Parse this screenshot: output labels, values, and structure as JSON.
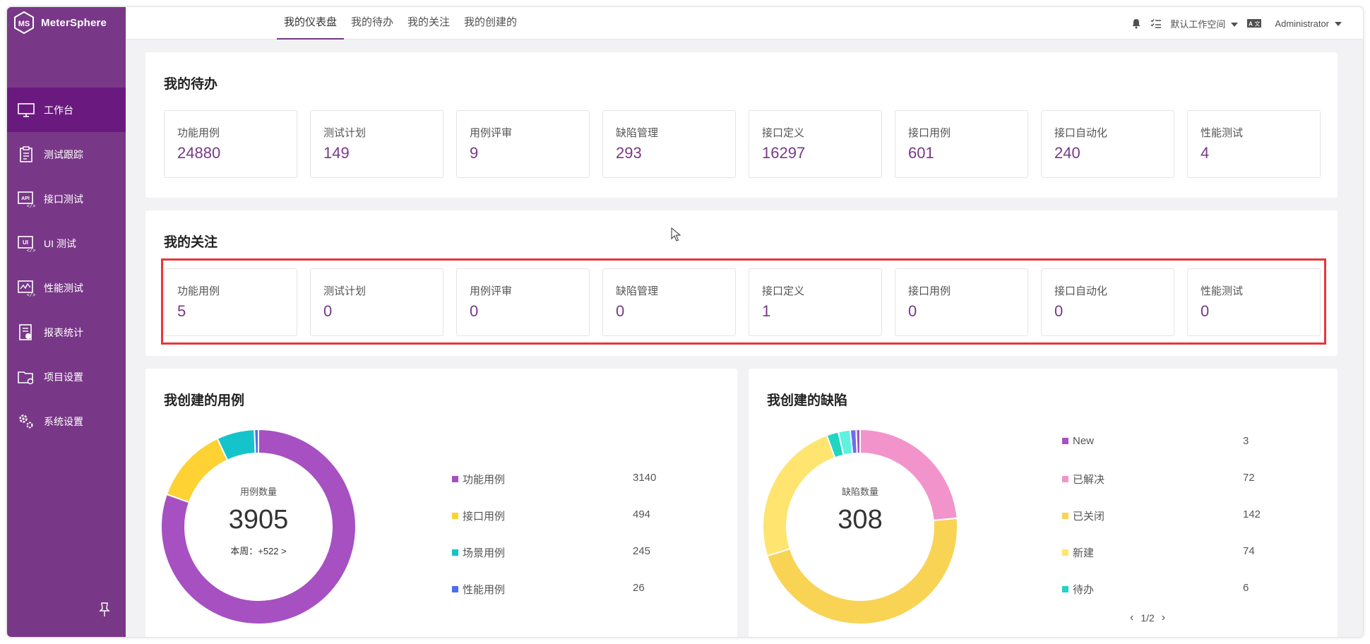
{
  "app": {
    "brand": "MeterSphere"
  },
  "sidebar": {
    "items": [
      {
        "label": "工作台",
        "icon": "monitor-icon"
      },
      {
        "label": "测试跟踪",
        "icon": "clipboard-icon"
      },
      {
        "label": "接口测试",
        "icon": "api-icon"
      },
      {
        "label": "UI 测试",
        "icon": "ui-icon"
      },
      {
        "label": "性能测试",
        "icon": "performance-icon"
      },
      {
        "label": "报表统计",
        "icon": "report-icon"
      },
      {
        "label": "项目设置",
        "icon": "folder-gear-icon"
      },
      {
        "label": "系统设置",
        "icon": "gears-icon"
      }
    ]
  },
  "topbar": {
    "tabs": [
      "我的仪表盘",
      "我的待办",
      "我的关注",
      "我的创建的"
    ],
    "workspace": "默认工作空间",
    "user": "Administrator"
  },
  "todo": {
    "title": "我的待办",
    "stats": [
      {
        "label": "功能用例",
        "value": "24880"
      },
      {
        "label": "测试计划",
        "value": "149"
      },
      {
        "label": "用例评审",
        "value": "9"
      },
      {
        "label": "缺陷管理",
        "value": "293"
      },
      {
        "label": "接口定义",
        "value": "16297"
      },
      {
        "label": "接口用例",
        "value": "601"
      },
      {
        "label": "接口自动化",
        "value": "240"
      },
      {
        "label": "性能测试",
        "value": "4"
      }
    ]
  },
  "follow": {
    "title": "我的关注",
    "stats": [
      {
        "label": "功能用例",
        "value": "5"
      },
      {
        "label": "测试计划",
        "value": "0"
      },
      {
        "label": "用例评审",
        "value": "0"
      },
      {
        "label": "缺陷管理",
        "value": "0"
      },
      {
        "label": "接口定义",
        "value": "1"
      },
      {
        "label": "接口用例",
        "value": "0"
      },
      {
        "label": "接口自动化",
        "value": "0"
      },
      {
        "label": "性能测试",
        "value": "0"
      }
    ]
  },
  "cases": {
    "title": "我创建的用例",
    "center_caption": "用例数量",
    "center_value": "3905",
    "weekly": "本周：+522 >"
  },
  "defects": {
    "title": "我创建的缺陷",
    "center_caption": "缺陷数量",
    "center_value": "308",
    "pager": "1/2"
  },
  "chart_data": [
    {
      "type": "pie",
      "title": "我创建的用例",
      "categories": [
        "功能用例",
        "接口用例",
        "场景用例",
        "性能用例"
      ],
      "values": [
        3140,
        494,
        245,
        26
      ],
      "colors": [
        "#a650c2",
        "#ffd234",
        "#14c4ca",
        "#4b6ef0"
      ],
      "legend_position": "right"
    },
    {
      "type": "pie",
      "title": "我创建的缺陷",
      "categories": [
        "New",
        "已解决",
        "已关闭",
        "新建",
        "待办"
      ],
      "values": [
        3,
        72,
        142,
        74,
        6
      ],
      "colors": [
        "#a650c2",
        "#f294cb",
        "#f9d354",
        "#ffe46f",
        "#1fd6c2"
      ],
      "extra_slices": [
        {
          "value": 6,
          "color": "#5ef2e0"
        },
        {
          "value": 3,
          "color": "#6b6ef0"
        },
        {
          "value": 2,
          "color": "#a650c2"
        }
      ],
      "legend_position": "right"
    }
  ]
}
